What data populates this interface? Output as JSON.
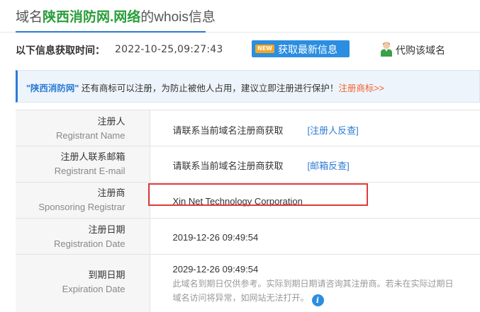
{
  "header": {
    "title_prefix": "域名",
    "title_domain": "陕西消防网.网络",
    "title_suffix": "的whois信息"
  },
  "fetch_info": {
    "label": "以下信息获取时间：",
    "time": "2022-10-25,09:27:43",
    "refresh_badge": "NEW",
    "refresh_label": "获取最新信息",
    "buy_label": "代购该域名"
  },
  "notice": {
    "quoted_name": "\"陕西消防网\"",
    "text": " 还有商标可以注册，为防止被他人占用，建议立即注册进行保护！",
    "link": "注册商标>>"
  },
  "rows": [
    {
      "label_cn": "注册人",
      "label_en": "Registrant Name",
      "value": "请联系当前域名注册商获取",
      "link": "[注册人反查]"
    },
    {
      "label_cn": "注册人联系邮箱",
      "label_en": "Registrant E-mail",
      "value": "请联系当前域名注册商获取",
      "link": "[邮箱反查]"
    },
    {
      "label_cn": "注册商",
      "label_en": "Sponsoring Registrar",
      "value": "Xin Net Technology Corporation"
    },
    {
      "label_cn": "注册日期",
      "label_en": "Registration Date",
      "value": "2019-12-26 09:49:54"
    },
    {
      "label_cn": "到期日期",
      "label_en": "Expiration Date",
      "value": "2029-12-26 09:49:54",
      "note1": "此域名到期日仅供参考。实际到期日期请咨询其注册商。若未在实际过期日",
      "note2": "域名访问将异常，如网站无法打开。",
      "info_icon": "i"
    }
  ],
  "colors": {
    "accent": "#2b7bd6",
    "domain_highlight": "#2a9d3a",
    "link_orange": "#f0622e",
    "highlight_box": "#e03a3a"
  }
}
